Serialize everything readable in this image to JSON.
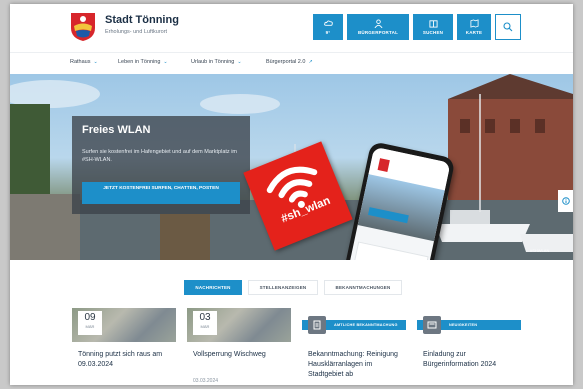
{
  "header": {
    "site_title": "Stadt Tönning",
    "site_subtitle": "Erholungs- und Luftkurort",
    "weather_label": "9°",
    "buttons": [
      {
        "label": "BÜRGERPORTAL",
        "icon": "person-icon"
      },
      {
        "label": "SUCHEN",
        "icon": "building-icon"
      },
      {
        "label": "KARTE",
        "icon": "map-icon"
      }
    ],
    "search_icon": "search-icon"
  },
  "nav": {
    "items": [
      {
        "label": "Rathaus"
      },
      {
        "label": "Leben in Tönning"
      },
      {
        "label": "Urlaub in Tönning"
      },
      {
        "label": "Bürgerportal 2.0"
      }
    ]
  },
  "hero": {
    "title": "Freies WLAN",
    "text": "Surfen sie kostenfrei im Hafengebiet und auf dem Marktplatz im #SH-WLAN.",
    "cta": "JETZT KOSTENFREI SURFEN, CHATTEN, POSTEN",
    "badge": "#sh_wlan",
    "credit": "#SHWLAN"
  },
  "tabs": [
    {
      "label": "NACHRICHTEN",
      "active": true
    },
    {
      "label": "STELLENANZEIGEN",
      "active": false
    },
    {
      "label": "BEKANNTMACHUNGEN",
      "active": false
    }
  ],
  "cards": [
    {
      "day": "09",
      "month": "MÄR",
      "title": "Tönning putzt sich raus am 09.03.2024",
      "date": ""
    },
    {
      "day": "03",
      "month": "MÄR",
      "title": "Vollsperrung Wischweg",
      "date": "03.03.2024"
    },
    {
      "bar": "AMTLICHE BEKANNTMACHUNG",
      "title": "Bekanntmachung: Reinigung Hausklärranlagen im Stadtgebiet ab",
      "date": ""
    },
    {
      "bar": "NEUIGKEITEN",
      "title": "Einladung zur Bürgerinformation 2024",
      "date": ""
    }
  ],
  "colors": {
    "accent": "#1d8fc9",
    "badge": "#e4221b",
    "title": "#1b2f45"
  }
}
